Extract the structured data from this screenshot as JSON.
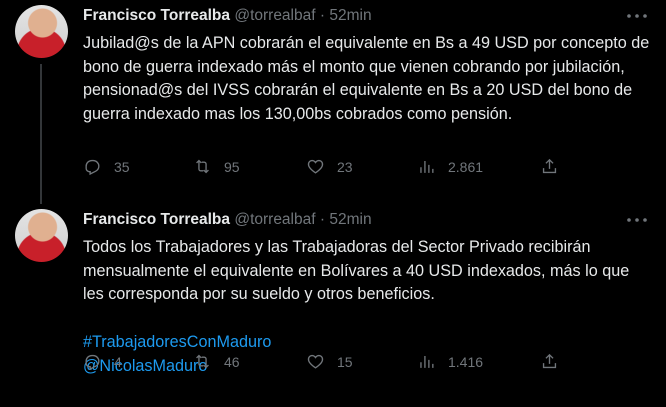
{
  "tweets": [
    {
      "name": "Francisco Torrealba",
      "handle": "@torrealbaf",
      "separator": "·",
      "time": "52min",
      "text": "Jubilad@s de la APN cobrarán el equivalente en Bs a 49 USD por concepto de bono de guerra indexado más el monto que vienen cobrando por jubilación, pensionad@s del IVSS cobrarán el equivalente en Bs a 20 USD del bono de guerra indexado mas los 130,00bs cobrados como pensión.",
      "replies": "35",
      "retweets": "95",
      "likes": "23",
      "views": "2.861"
    },
    {
      "name": "Francisco Torrealba",
      "handle": "@torrealbaf",
      "separator": "·",
      "time": "52min",
      "text": "Todos los Trabajadores y las Trabajadoras del Sector Privado recibirán mensualmente el equivalente en Bolívares a 40 USD indexados, más lo que les corresponda por su sueldo y otros beneficios.",
      "hashtag": "#TrabajadoresConMaduro",
      "mention": "@NicolasMaduro",
      "replies": "4",
      "retweets": "46",
      "likes": "15",
      "views": "1.416"
    }
  ],
  "icons": {
    "reply": "reply-icon",
    "retweet": "retweet-icon",
    "like": "heart-icon",
    "views": "views-icon",
    "share": "share-icon",
    "more": "more-options-icon"
  },
  "colors": {
    "background": "#000000",
    "text": "#e7e9ea",
    "muted": "#71767b",
    "link": "#1d9bf0"
  }
}
